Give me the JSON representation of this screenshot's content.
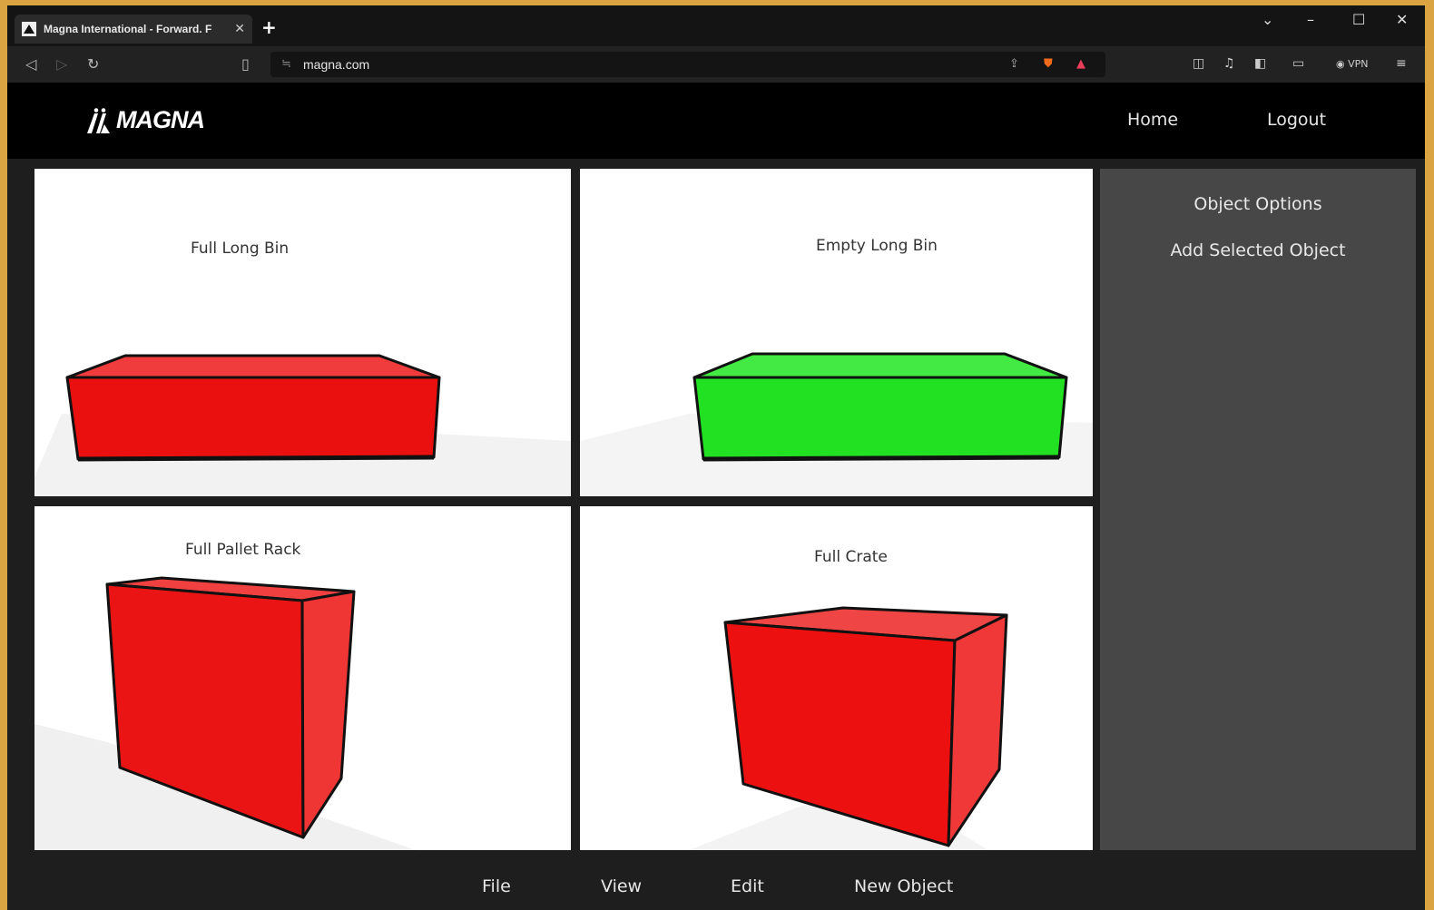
{
  "browser": {
    "tab_title": "Magna International - Forward. F",
    "tab_close": "✕",
    "new_tab": "+",
    "url": "magna.com",
    "vpn_label": "VPN"
  },
  "header": {
    "logo_text": "MAGNA",
    "nav": {
      "home": "Home",
      "logout": "Logout"
    }
  },
  "panels": [
    {
      "label": "Full Long Bin",
      "color": "#ee1111",
      "state": "full"
    },
    {
      "label": "Empty Long Bin",
      "color": "#33e633",
      "state": "empty"
    },
    {
      "label": "Full Pallet Rack",
      "color": "#ee1111",
      "state": "full"
    },
    {
      "label": "Full Crate",
      "color": "#ee1111",
      "state": "full"
    }
  ],
  "options": {
    "title": "Object Options",
    "add_selected": "Add Selected Object"
  },
  "menu": {
    "file": "File",
    "view": "View",
    "edit": "Edit",
    "new_object": "New Object"
  }
}
